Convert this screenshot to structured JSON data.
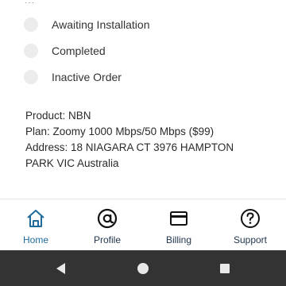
{
  "status_list": {
    "partial_label": "…",
    "items": [
      {
        "label": "Awaiting Installation"
      },
      {
        "label": "Completed"
      },
      {
        "label": "Inactive Order"
      }
    ]
  },
  "details": {
    "product": "Product: NBN",
    "plan": "Plan: Zoomy 1000 Mbps/50 Mbps ($99)",
    "address_line1": "Address: 18 NIAGARA CT 3976 HAMPTON",
    "address_line2": "PARK VIC Australia"
  },
  "bottom_nav": {
    "items": [
      {
        "label": "Home",
        "icon": "home-icon"
      },
      {
        "label": "Profile",
        "icon": "at-sign-icon"
      },
      {
        "label": "Billing",
        "icon": "credit-card-icon"
      },
      {
        "label": "Support",
        "icon": "help-icon"
      }
    ]
  },
  "colors": {
    "nav_active": "#1f6b9a",
    "nav_text": "#22384f",
    "system_bar": "#333333"
  }
}
